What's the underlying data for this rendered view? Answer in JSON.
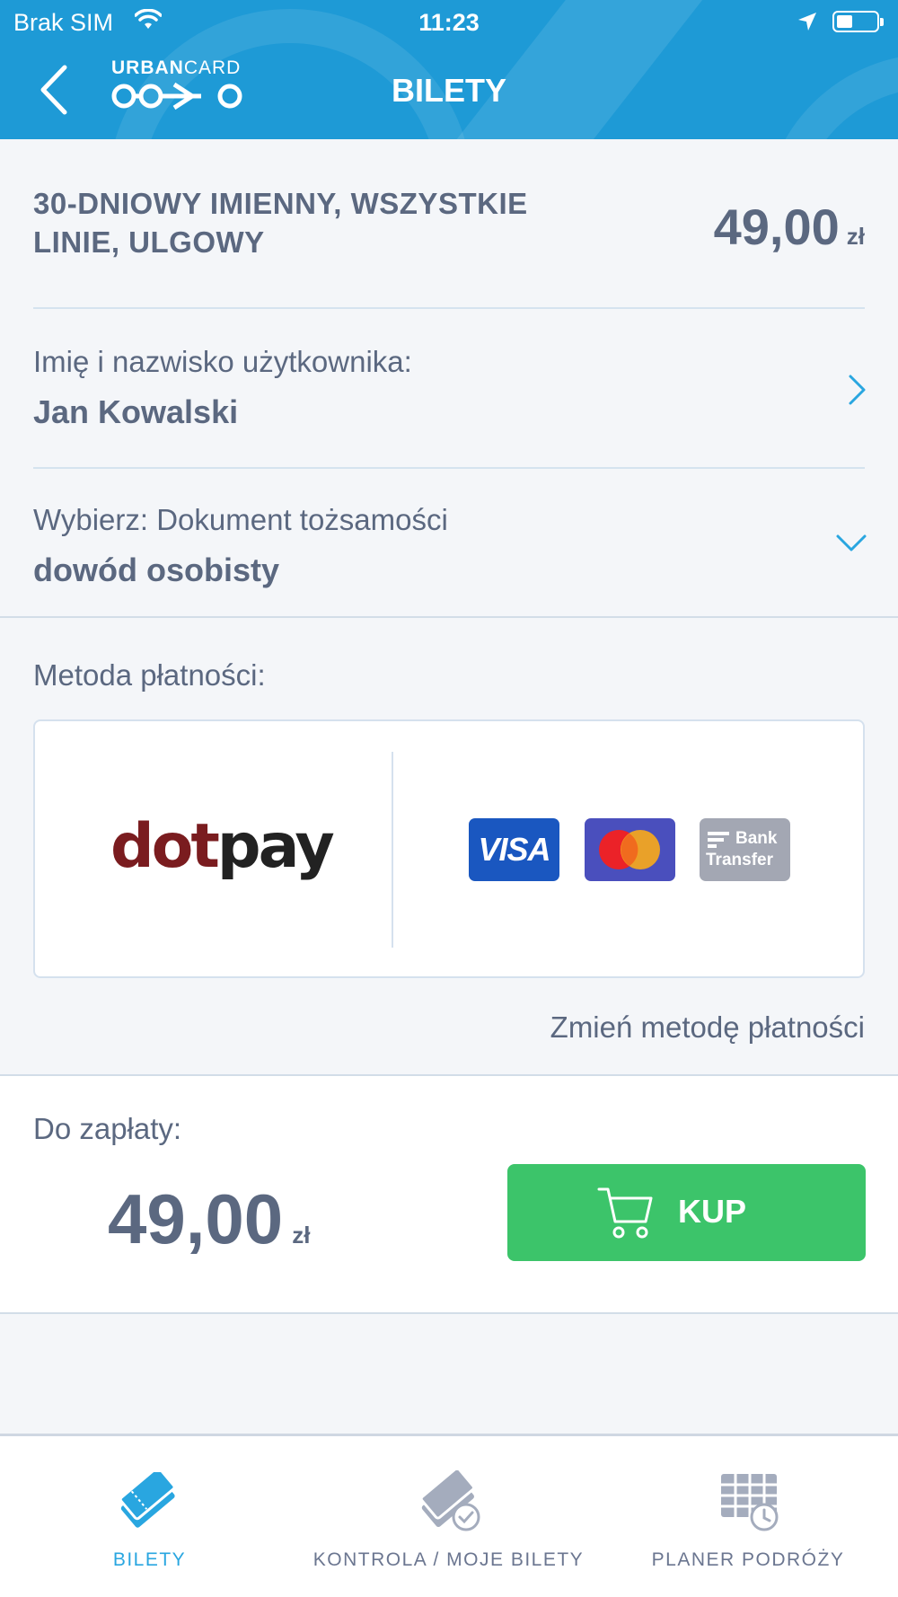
{
  "status_bar": {
    "carrier": "Brak SIM",
    "time": "11:23"
  },
  "header": {
    "logo_bold": "URBAN",
    "logo_light": "CARD",
    "title": "BILETY"
  },
  "ticket": {
    "name": "30-DNIOWY IMIENNY, WSZYSTKIE LINIE, ULGOWY",
    "price": "49,00",
    "currency": "zł"
  },
  "user_row": {
    "label": "Imię i nazwisko użytkownika:",
    "value": "Jan Kowalski"
  },
  "document_row": {
    "label": "Wybierz: Dokument tożsamości",
    "value": "dowód osobisty"
  },
  "payment": {
    "label": "Metoda płatności:",
    "provider_dot": "dot",
    "provider_pay": "pay",
    "visa_label": "VISA",
    "bank_line1": "Bank",
    "bank_line2": "Transfer",
    "change_link": "Zmień metodę płatności"
  },
  "total": {
    "label": "Do zapłaty:",
    "amount": "49,00",
    "currency": "zł",
    "buy_label": "KUP"
  },
  "tabs": [
    {
      "label": "BILETY",
      "icon": "tickets-icon",
      "active": true
    },
    {
      "label": "KONTROLA / MOJE BILETY",
      "icon": "ticket-check-icon",
      "active": false
    },
    {
      "label": "PLANER PODRÓŻY",
      "icon": "schedule-icon",
      "active": false
    }
  ],
  "colors": {
    "header": "#1e9ad6",
    "accent": "#29a6e0",
    "buy": "#3cc46a",
    "text": "#5b6880"
  }
}
